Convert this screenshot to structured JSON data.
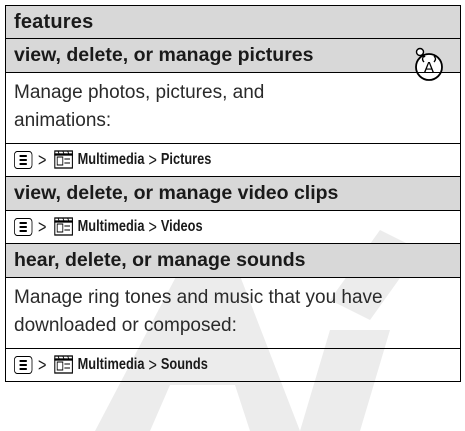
{
  "table": {
    "header": "features",
    "sections": [
      {
        "heading": "view, delete, or manage pictures",
        "description": "Manage photos, pictures, and animations:",
        "path": {
          "menu": "Multimedia",
          "item": "Pictures"
        },
        "icon": "network-feature-icon"
      },
      {
        "heading": "view, delete, or manage video clips",
        "path": {
          "menu": "Multimedia",
          "item": "Videos"
        }
      },
      {
        "heading": "hear, delete, or manage sounds",
        "description": "Manage ring tones and music that you have downloaded or composed:",
        "path": {
          "menu": "Multimedia",
          "item": "Sounds"
        }
      }
    ],
    "separator": ">",
    "icons": {
      "menu_key": "menu-key-icon",
      "multimedia": "multimedia-film-icon"
    }
  },
  "watermark": {
    "color": "#e6e6e6"
  }
}
